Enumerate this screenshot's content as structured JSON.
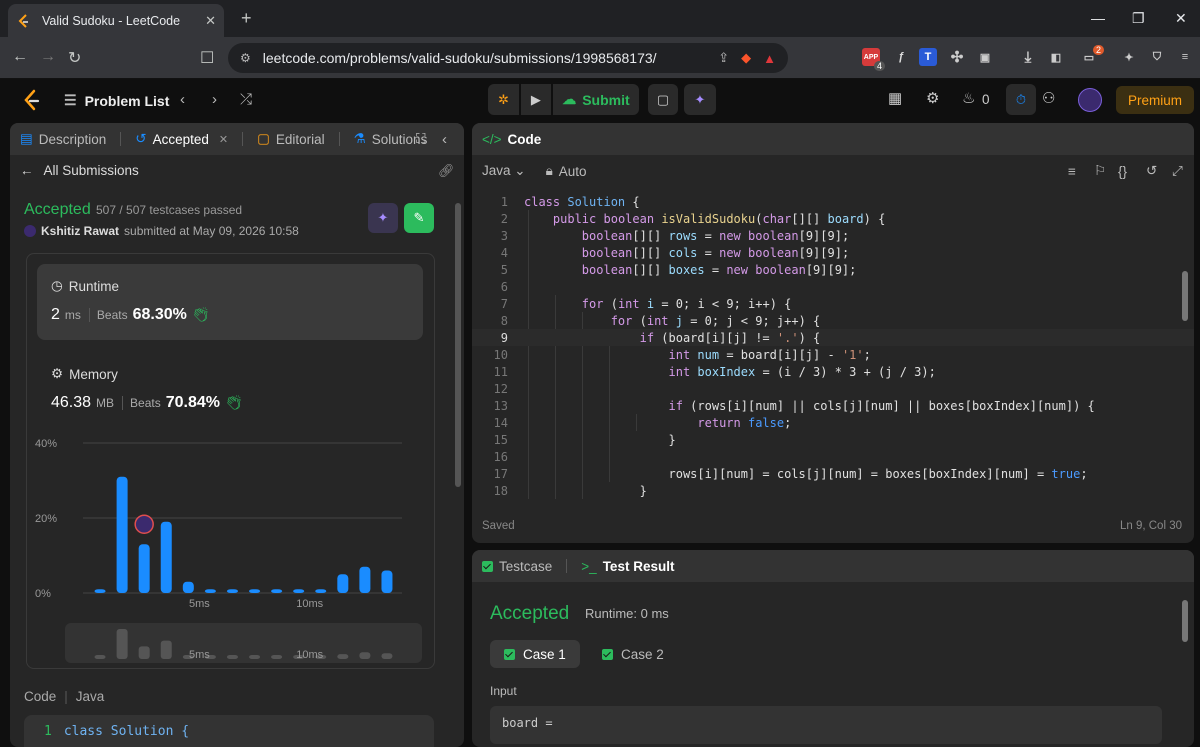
{
  "browser": {
    "tab_title": "Valid Sudoku - LeetCode",
    "url": "leetcode.com/problems/valid-sudoku/submissions/1998568173/",
    "ext_badge_1": "4",
    "ext_badge_2": "2",
    "ext_label_1": "APP",
    "ext_label_2": "T"
  },
  "nav": {
    "problem_list": "Problem List",
    "submit": "Submit",
    "streak": "0",
    "premium": "Premium"
  },
  "left": {
    "tabs": [
      "Description",
      "Accepted",
      "Editorial",
      "Solutions"
    ],
    "back": "All Submissions",
    "status": "Accepted",
    "testcases": "507 / 507 testcases passed",
    "user": "Kshitiz Rawat",
    "submitted": "submitted at May 09, 2026 10:58",
    "runtime": {
      "title": "Runtime",
      "value": "2",
      "unit": "ms",
      "beats_label": "Beats",
      "beats": "68.30%"
    },
    "memory": {
      "title": "Memory",
      "value": "46.38",
      "unit": "MB",
      "beats_label": "Beats",
      "beats": "70.84%"
    },
    "code_label": "Code",
    "code_lang": "Java",
    "mini_line_no": "1",
    "mini_code": "class Solution {"
  },
  "chart_data": {
    "type": "bar",
    "y_ticks": [
      "40%",
      "20%",
      "0%"
    ],
    "x_ticks": [
      "5ms",
      "10ms"
    ],
    "ylim": [
      0,
      40
    ],
    "values": [
      1,
      31,
      13,
      19,
      3,
      1,
      1,
      1,
      1,
      1,
      1,
      5,
      7,
      6
    ],
    "highlight_index": 2,
    "overview_values": [
      1,
      31,
      13,
      19,
      3,
      1,
      1,
      1,
      1,
      1,
      1,
      5,
      7,
      6
    ],
    "overview_ticks": [
      "5ms",
      "10ms"
    ],
    "bar_color": "#1a8cff"
  },
  "code": {
    "title": "Code",
    "lang": "Java",
    "mode": "Auto",
    "saved": "Saved",
    "cursor": "Ln 9, Col 30",
    "current_line": 9
  },
  "test": {
    "tab1": "Testcase",
    "tab2": "Test Result",
    "status": "Accepted",
    "runtime": "Runtime: 0 ms",
    "case1": "Case 1",
    "case2": "Case 2",
    "input_label": "Input",
    "board": "board ="
  }
}
